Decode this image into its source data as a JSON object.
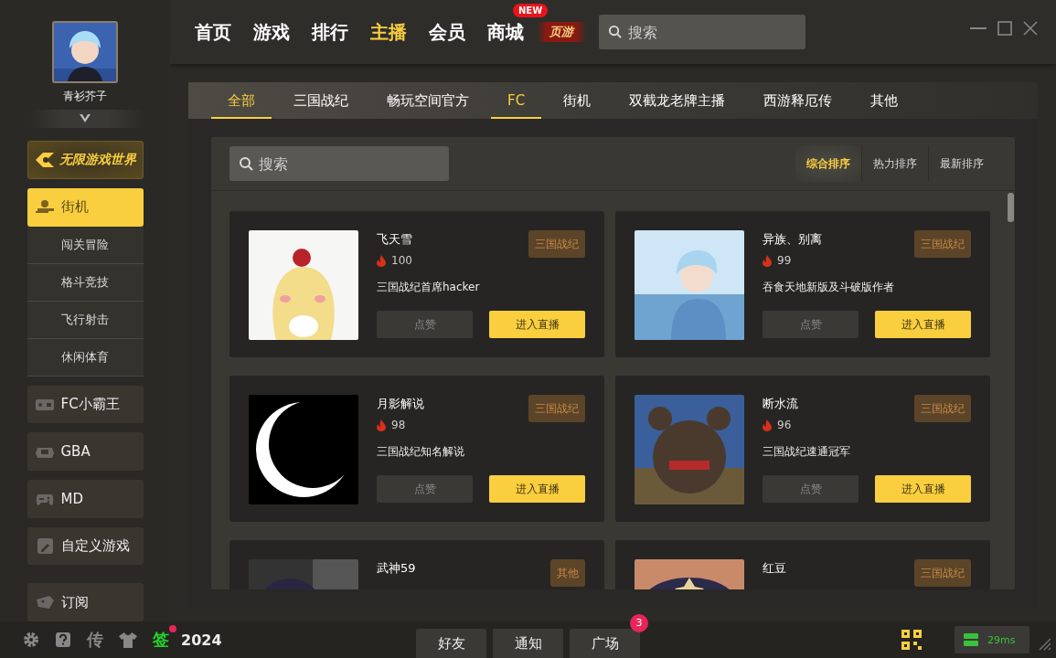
{
  "user": {
    "name": "青衫芥子"
  },
  "sidebar": {
    "banner": "无限游戏世界",
    "items": [
      {
        "label": "街机",
        "selected": true,
        "children": [
          {
            "label": "闯关冒险",
            "selected": false
          },
          {
            "label": "格斗竞技",
            "selected": false
          },
          {
            "label": "飞行射击",
            "selected": false
          },
          {
            "label": "休闲体育",
            "selected": false
          }
        ]
      },
      {
        "label": "FC小霸王",
        "selected": false
      },
      {
        "label": "GBA",
        "selected": false
      },
      {
        "label": "MD",
        "selected": false
      },
      {
        "label": "自定义游戏",
        "selected": false
      },
      {
        "label": "订阅",
        "selected": false
      }
    ]
  },
  "nav": {
    "items": [
      {
        "label": "首页",
        "selected": false
      },
      {
        "label": "游戏",
        "selected": false
      },
      {
        "label": "排行",
        "selected": false
      },
      {
        "label": "主播",
        "selected": true
      },
      {
        "label": "会员",
        "selected": false
      },
      {
        "label": "商城",
        "selected": false,
        "badge": "NEW"
      }
    ],
    "logo": "页游",
    "search": {
      "placeholder": "搜索"
    }
  },
  "tabs": [
    {
      "label": "全部",
      "selected": true
    },
    {
      "label": "三国战纪",
      "selected": false
    },
    {
      "label": "畅玩空间官方",
      "selected": false
    },
    {
      "label": "FC",
      "selected": true
    },
    {
      "label": "街机",
      "selected": false
    },
    {
      "label": "双截龙老牌主播",
      "selected": false
    },
    {
      "label": "西游释厄传",
      "selected": false
    },
    {
      "label": "其他",
      "selected": false
    }
  ],
  "search": {
    "placeholder": "搜索"
  },
  "sort": [
    {
      "label": "综合排序",
      "selected": true
    },
    {
      "label": "热力排序",
      "selected": false
    },
    {
      "label": "最新排序",
      "selected": false
    }
  ],
  "streamers": [
    {
      "name": "飞天雪",
      "tag": "三国战纪",
      "heat": "100",
      "desc": "三国战纪首席hacker",
      "like": "点赞",
      "enter": "进入直播"
    },
    {
      "name": "异族、别离",
      "tag": "三国战纪",
      "heat": "99",
      "desc": "吞食天地新版及斗破版作者",
      "like": "点赞",
      "enter": "进入直播"
    },
    {
      "name": "月影解说",
      "tag": "三国战纪",
      "heat": "98",
      "desc": "三国战纪知名解说",
      "like": "点赞",
      "enter": "进入直播"
    },
    {
      "name": "断水流",
      "tag": "三国战纪",
      "heat": "96",
      "desc": "三国战纪速通冠军",
      "like": "点赞",
      "enter": "进入直播"
    },
    {
      "name": "武神59",
      "tag": "其他"
    },
    {
      "name": "红豆",
      "tag": "三国战纪"
    }
  ],
  "status_bar": {
    "tools": [
      "传",
      "签"
    ],
    "sign_dot": true,
    "year": "2024",
    "buttons": [
      {
        "label": "好友"
      },
      {
        "label": "通知"
      },
      {
        "label": "广场",
        "badge": "3"
      }
    ],
    "ping": "29ms"
  }
}
